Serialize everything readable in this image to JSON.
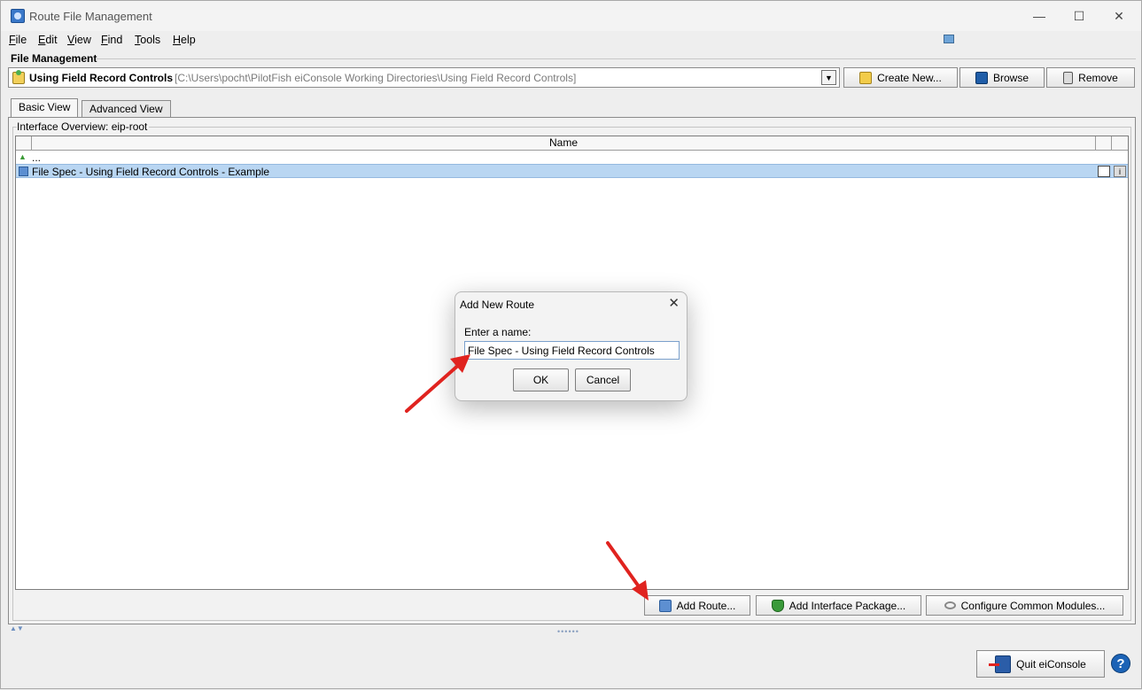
{
  "window": {
    "title": "Route File Management"
  },
  "menu": [
    {
      "label": "File",
      "key": "F",
      "rest": "ile"
    },
    {
      "label": "Edit",
      "key": "E",
      "rest": "dit"
    },
    {
      "label": "View",
      "key": "V",
      "rest": "iew"
    },
    {
      "label": "Find",
      "key": "F",
      "rest": "ind"
    },
    {
      "label": "Tools",
      "key": "T",
      "rest": "ools"
    },
    {
      "label": "Help",
      "key": "H",
      "rest": "elp"
    }
  ],
  "file_management": {
    "label": "File Management",
    "working_dir_name": "Using Field Record Controls",
    "working_dir_path": "[C:\\Users\\pocht\\PilotFish eiConsole Working Directories\\Using Field Record Controls]",
    "create_new_label": "Create New...",
    "browse_label": "Browse",
    "remove_label": "Remove"
  },
  "tabs": [
    {
      "label": "Basic View",
      "active": true
    },
    {
      "label": "Advanced View",
      "active": false
    }
  ],
  "overview": {
    "group_label": "Interface Overview: eip-root",
    "column_name": "Name",
    "rows": [
      {
        "label": "...",
        "icon": "up-arrow-icon",
        "selected": false
      },
      {
        "label": "File Spec - Using Field Record Controls - Example",
        "icon": "route-icon",
        "selected": true
      }
    ]
  },
  "bottom_buttons": {
    "add_route": "Add Route...",
    "add_interface_package": "Add Interface Package...",
    "configure_common_modules": "Configure Common Modules..."
  },
  "quit_label": "Quit eiConsole",
  "help_glyph": "?",
  "dialog": {
    "title": "Add New Route",
    "prompt": "Enter a name:",
    "input_value": "File Spec - Using Field Record Controls",
    "ok_label": "OK",
    "cancel_label": "Cancel"
  },
  "colors": {
    "selection": "#b9d6f2",
    "annotation_arrow": "#e0231f"
  }
}
